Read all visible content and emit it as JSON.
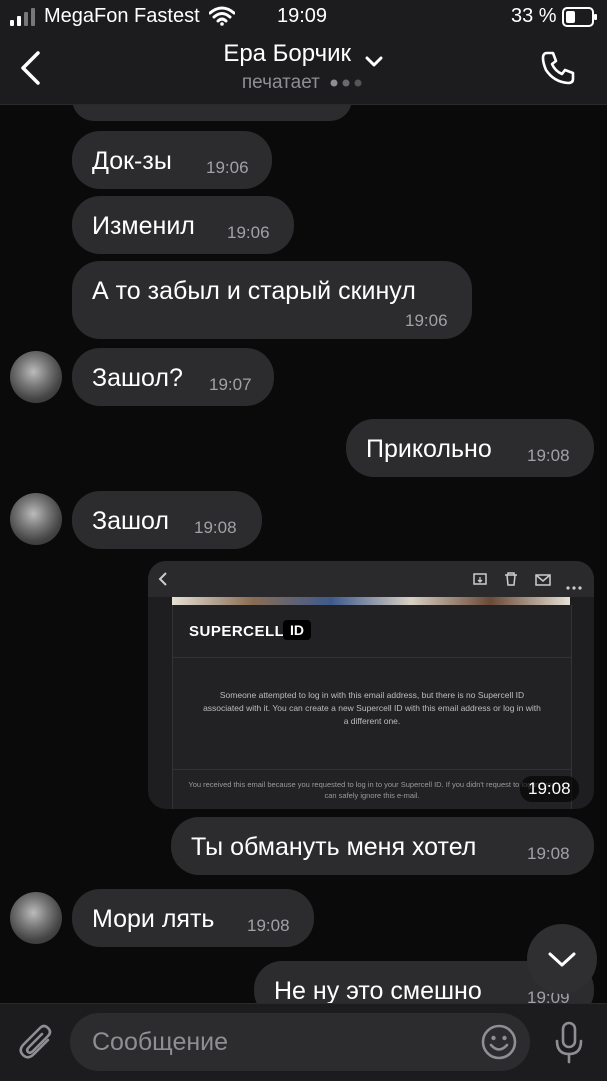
{
  "status": {
    "carrier": "MegaFon Fastest",
    "time": "19:09",
    "battery": "33 %"
  },
  "header": {
    "name": "Ера Борчик",
    "status": "печатает"
  },
  "messages": [
    {
      "text": "Док-зы",
      "time": "19:06"
    },
    {
      "text": "Изменил",
      "time": "19:06"
    },
    {
      "text": "А то забыл и старый скинул",
      "time": "19:06"
    },
    {
      "text": "Зашол?",
      "time": "19:07"
    },
    {
      "text": "Прикольно",
      "time": "19:08"
    },
    {
      "text": "Зашол",
      "time": "19:08"
    },
    {
      "text": "Ты обмануть меня хотел",
      "time": "19:08"
    },
    {
      "text": "Мори лять",
      "time": "19:08"
    },
    {
      "text": "Не ну это смешно",
      "time": "19:09"
    }
  ],
  "screenshot_message": {
    "time": "19:08",
    "brand": "SUPERCELL",
    "brand_badge": "ID",
    "body": "Someone attempted to log in with this email address, but there is no Supercell ID associated with it. You can create a new Supercell ID with this email address or log in with a different one.",
    "footer": "You received this email because you requested to log in to your Supercell ID. If you didn't request to log in, you can safely ignore this e-mail."
  },
  "composer": {
    "placeholder": "Сообщение"
  },
  "icons": [
    "signal-icon",
    "wifi-icon",
    "battery-icon",
    "back-chevron-icon",
    "chevron-down-icon",
    "phone-icon",
    "attach-icon",
    "emoji-icon",
    "microphone-icon",
    "scroll-down-icon"
  ]
}
